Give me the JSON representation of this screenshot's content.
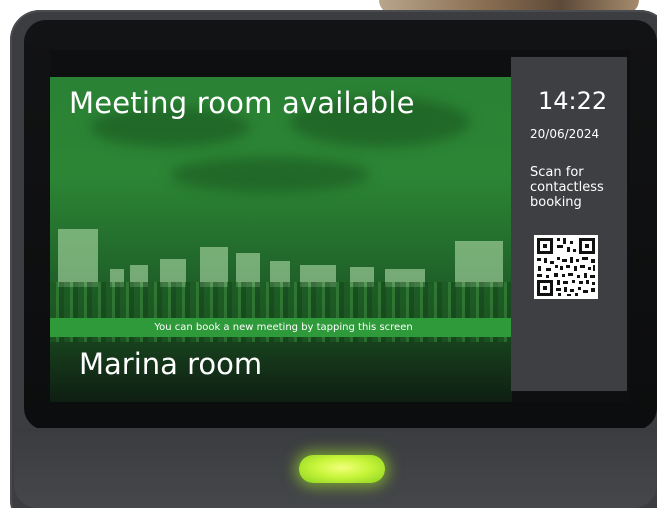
{
  "screen": {
    "status_title": "Meeting room available",
    "room_name": "Marina room",
    "banner_text": "You can book a new meeting by tapping this screen"
  },
  "side_panel": {
    "time": "14:22",
    "date": "20/06/2024",
    "scan_text": "Scan for contactless booking",
    "qr_icon": "qr-code-icon"
  },
  "device": {
    "indicator_led": "status-led-icon"
  },
  "colors": {
    "available_green": "#2e9a3a",
    "led_glow": "#c7f53a",
    "panel_bg": "#3d3f42",
    "device_body": "#3b3d40"
  }
}
